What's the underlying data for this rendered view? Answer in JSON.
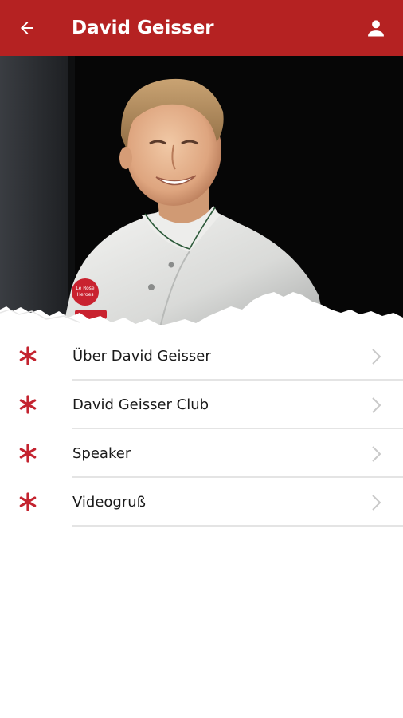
{
  "header": {
    "title": "David Geisser",
    "back_icon": "arrow-left-icon",
    "profile_icon": "person-icon",
    "background": "#b52222"
  },
  "hero": {
    "subject": "chef portrait",
    "patch_text": "Le Rosé Heroes"
  },
  "menu": {
    "items": [
      {
        "label": "Über David Geisser",
        "icon": "asterisk-icon"
      },
      {
        "label": "David Geisser Club",
        "icon": "asterisk-icon"
      },
      {
        "label": "Speaker",
        "icon": "asterisk-icon"
      },
      {
        "label": "Videogruß",
        "icon": "asterisk-icon"
      }
    ],
    "accent": "#c4232f"
  }
}
